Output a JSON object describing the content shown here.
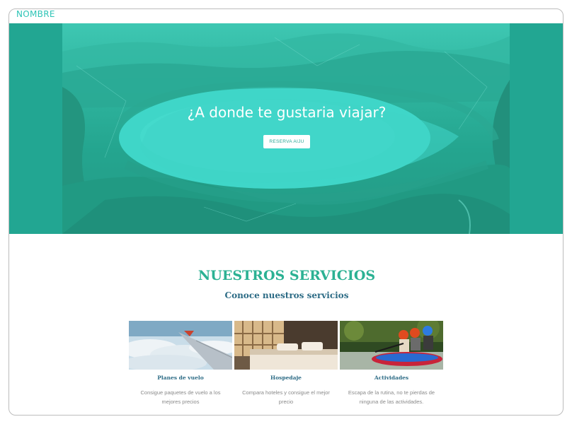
{
  "header": {
    "brand": "NOMBRE"
  },
  "hero": {
    "title": "¿A donde te gustaria viajar?",
    "button_label": "RESERVA AIJU"
  },
  "services": {
    "title": "NUESTROS SERVICIOS",
    "subtitle": "Conoce nuestros servicios",
    "cards": [
      {
        "title": "Planes de vuelo",
        "description": "Consigue paquetes de vuelo a los mejores precios",
        "image": "airplane-wing-image"
      },
      {
        "title": "Hospedaje",
        "description": "Compara hoteles y consigue el mejor precio",
        "image": "hotel-room-image"
      },
      {
        "title": "Actividades",
        "description": "Escapa de la rutina, no te pierdas de ninguna de las actividades.",
        "image": "rafting-image"
      }
    ]
  },
  "colors": {
    "accent": "#2bb193",
    "hero_teal": "#22a692",
    "heading_blue": "#2c6b85"
  }
}
